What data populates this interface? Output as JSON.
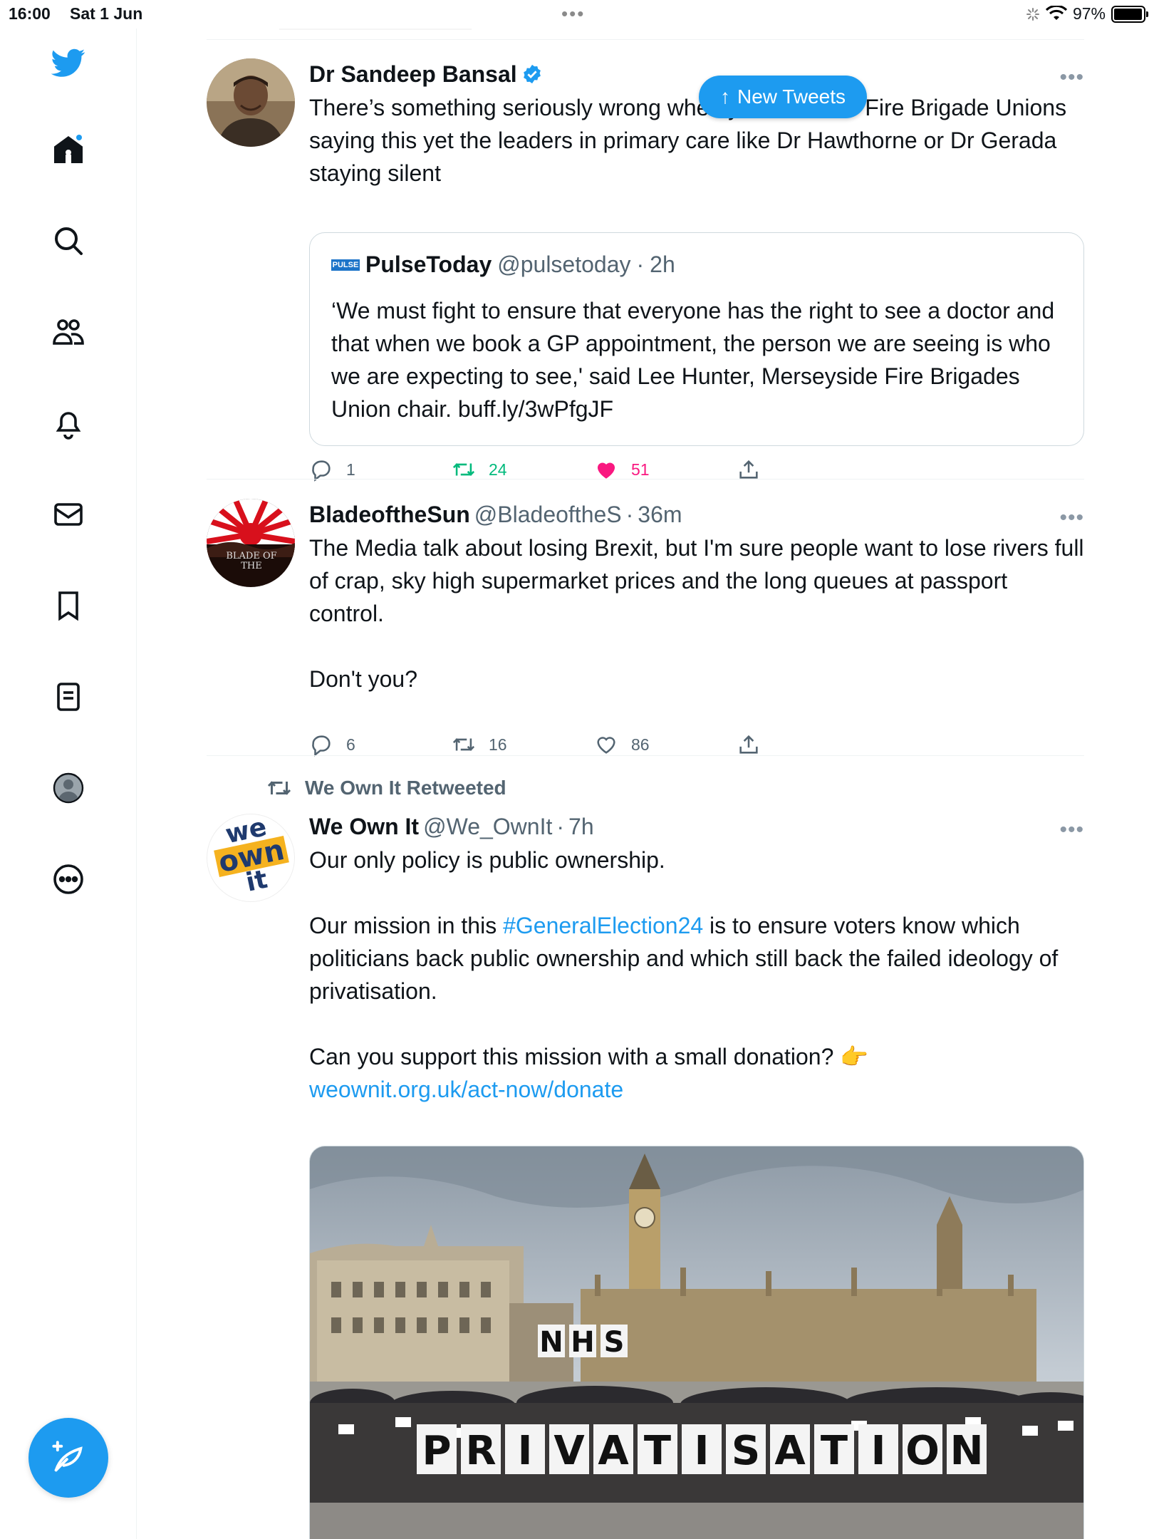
{
  "status": {
    "time": "16:00",
    "date": "Sat 1 Jun",
    "battery": "97%",
    "battery_level": 0.97
  },
  "nav": {
    "items": [
      "twitter-logo",
      "home",
      "explore",
      "communities",
      "notifications",
      "messages",
      "bookmarks",
      "lists",
      "profile",
      "more"
    ]
  },
  "banner": {
    "label": "New Tweets"
  },
  "tweets": [
    {
      "name": "Dr Sandeep Bansal",
      "verified": true,
      "text": "There’s something seriously wrong when you have the Fire Brigade Unions saying this yet the leaders in primary care like Dr Hawthorne or Dr Gerada staying silent",
      "quote": {
        "logo": "PULSE",
        "name": "PulseToday",
        "handle": "@pulsetoday",
        "sep": "·",
        "time": "2h",
        "text": "‘We must fight to ensure that everyone has the right to see a doctor and that when we book a GP appointment, the person we are seeing is who we are expecting to see,' said Lee Hunter, Merseyside Fire Brigades Union chair. buff.ly/3wPfgJF"
      },
      "replies": "1",
      "retweets": "24",
      "likes": "51"
    },
    {
      "name": "BladeoftheSun",
      "handle": "@BladeoftheS",
      "sep": "·",
      "time": "36m",
      "avatar_text": "BLADE OF THE",
      "text": "The Media talk about losing Brexit, but I'm sure people want to lose rivers full of crap, sky high supermarket prices and the long queues at passport control.\n\nDon't you?",
      "replies": "6",
      "retweets": "16",
      "likes": "86"
    },
    {
      "retweeted_by": "We Own It Retweeted",
      "name": "We Own It",
      "handle": "@We_OwnIt",
      "sep": "·",
      "time": "7h",
      "avatar_text": [
        "we",
        "own",
        "it"
      ],
      "text_1": "Our only policy is public ownership.",
      "text_2a": "Our mission in this ",
      "hashtag": "#GeneralElection24",
      "text_2b": " is to ensure voters know which politicians back public ownership and which still back the failed ideology of privatisation.",
      "text_3": "Can you support this mission with a small donation? 👉",
      "url": "weownit.org.uk/act-now/donate",
      "image_letters_top": [
        "N",
        "H",
        "S"
      ],
      "image_letters_mid": [
        "P",
        "R",
        "I",
        "V",
        "A",
        "T",
        "I",
        "S",
        "A",
        "T",
        "I",
        "O",
        "N"
      ]
    }
  ],
  "colors": {
    "accent": "#1d9bf0",
    "like": "#f91880",
    "retweet": "#00ba7c",
    "muted": "#536471"
  }
}
